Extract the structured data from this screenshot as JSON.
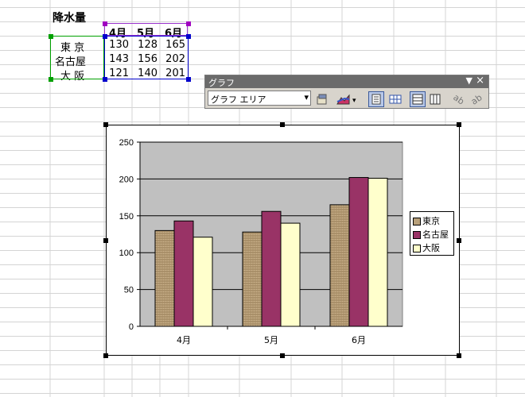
{
  "sheet": {
    "title": "降水量",
    "months": [
      "4月",
      "5月",
      "6月"
    ],
    "rows": [
      {
        "city": "東 京",
        "values": [
          "130",
          "128",
          "165"
        ]
      },
      {
        "city": "名古屋",
        "values": [
          "143",
          "156",
          "202"
        ]
      },
      {
        "city": "大 阪",
        "values": [
          "121",
          "140",
          "201"
        ]
      }
    ]
  },
  "toolbar": {
    "title": "グラフ",
    "object_select": "グラフ エリア",
    "close_glyph": "×",
    "dropdown_glyph": "▾"
  },
  "chart_data": {
    "type": "bar",
    "categories": [
      "4月",
      "5月",
      "6月"
    ],
    "series": [
      {
        "name": "東京",
        "values": [
          130,
          128,
          165
        ],
        "color": "#b8a07a"
      },
      {
        "name": "名古屋",
        "values": [
          143,
          156,
          202
        ],
        "color": "#993366"
      },
      {
        "name": "大阪",
        "values": [
          121,
          140,
          201
        ],
        "color": "#ffffcc"
      }
    ],
    "ylim": [
      0,
      250
    ],
    "yticks": [
      "0",
      "50",
      "100",
      "150",
      "200",
      "250"
    ],
    "grid": true,
    "plot_background": "#c0c0c0",
    "legend": "right"
  }
}
